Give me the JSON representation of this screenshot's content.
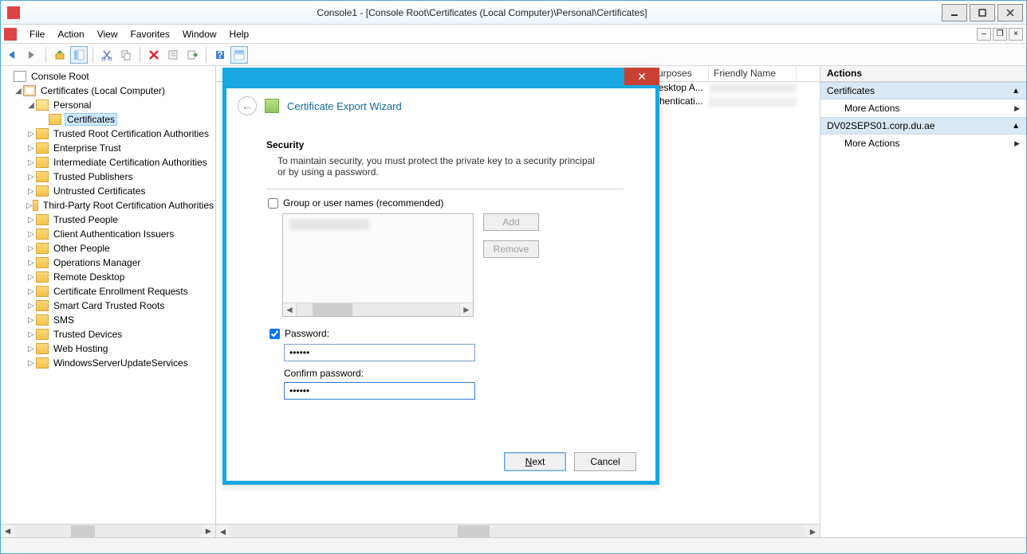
{
  "window": {
    "title": "Console1 - [Console Root\\Certificates (Local Computer)\\Personal\\Certificates]"
  },
  "menu": {
    "file": "File",
    "action": "Action",
    "view": "View",
    "favorites": "Favorites",
    "window": "Window",
    "help": "Help"
  },
  "tree": {
    "root": "Console Root",
    "certs_root": "Certificates (Local Computer)",
    "personal": "Personal",
    "personal_certs": "Certificates",
    "items": [
      "Trusted Root Certification Authorities",
      "Enterprise Trust",
      "Intermediate Certification Authorities",
      "Trusted Publishers",
      "Untrusted Certificates",
      "Third-Party Root Certification Authorities",
      "Trusted People",
      "Client Authentication Issuers",
      "Other People",
      "Operations Manager",
      "Remote Desktop",
      "Certificate Enrollment Requests",
      "Smart Card Trusted Roots",
      "SMS",
      "Trusted Devices",
      "Web Hosting",
      "WindowsServerUpdateServices"
    ]
  },
  "list": {
    "col_purposes": "Purposes",
    "col_friendly": "Friendly Name",
    "rows": [
      {
        "purposes": "Desktop A..."
      },
      {
        "purposes": "uthenticati..."
      }
    ]
  },
  "actions": {
    "title": "Actions",
    "group1": "Certificates",
    "more1": "More Actions",
    "group2": "DV02SEPS01.corp.du.ae",
    "more2": "More Actions"
  },
  "wizard": {
    "title": "Certificate Export Wizard",
    "section_title": "Security",
    "section_desc": "To maintain security, you must protect the private key to a security principal or by using a password.",
    "cb_group": "Group or user names (recommended)",
    "btn_add": "Add",
    "btn_remove": "Remove",
    "cb_password": "Password:",
    "password_value": "••••••",
    "confirm_label": "Confirm password:",
    "confirm_value": "••••••",
    "btn_next": "Next",
    "btn_cancel": "Cancel"
  }
}
